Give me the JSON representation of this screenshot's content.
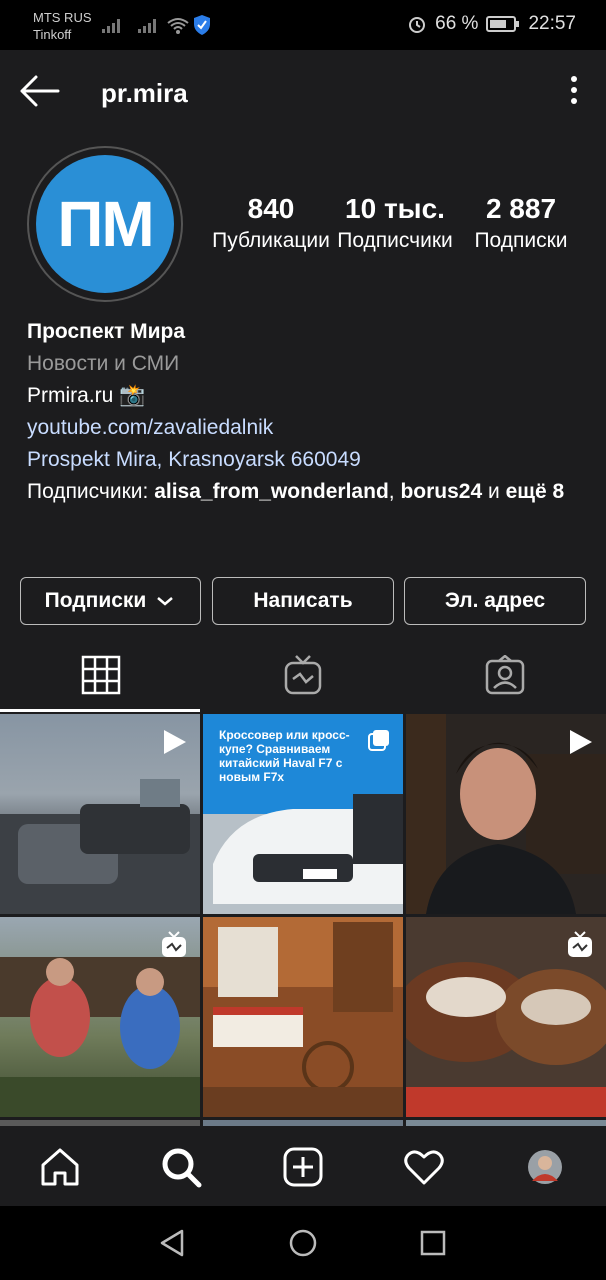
{
  "status_bar": {
    "carrier_1": "MTS RUS",
    "carrier_2": "Tinkoff",
    "battery": "66 %",
    "time": "22:57"
  },
  "header": {
    "username": "pr.mira"
  },
  "profile": {
    "avatar_initials": "ПМ",
    "stats": {
      "posts_count": "840",
      "posts_label": "Публикации",
      "followers_count": "10 тыс.",
      "followers_label": "Подписчики",
      "following_count": "2 887",
      "following_label": "Подписки"
    },
    "bio": {
      "name": "Проспект Мира",
      "category": "Новости и СМИ",
      "website": "Prmira.ru 📸",
      "youtube": "youtube.com/zavaliedalnik",
      "address": "Prospekt Mira, Krasnoyarsk 660049",
      "followed_by_prefix": "Подписчики: ",
      "followed_by_user1": "alisa_from_wonderland",
      "followed_by_sep": ", ",
      "followed_by_user2": "borus24",
      "followed_by_suffix": " и ",
      "followed_by_more": "ещё 8"
    }
  },
  "actions": {
    "following_label": "Подписки",
    "message_label": "Написать",
    "email_label": "Эл. адрес"
  },
  "grid": {
    "posts": [
      {
        "type": "video",
        "caption": ""
      },
      {
        "type": "carousel",
        "caption": "Кроссовер или кросс-купе? Сравниваем китайский Haval F7 с новым F7x"
      },
      {
        "type": "video",
        "caption": ""
      },
      {
        "type": "igtv",
        "caption": ""
      },
      {
        "type": "photo",
        "caption": ""
      },
      {
        "type": "igtv",
        "caption": ""
      }
    ]
  },
  "colors": {
    "background": "#1c1c1e",
    "brand_blue": "#2a8fd6",
    "link": "#c8dcff",
    "muted": "#9a9a9a"
  }
}
